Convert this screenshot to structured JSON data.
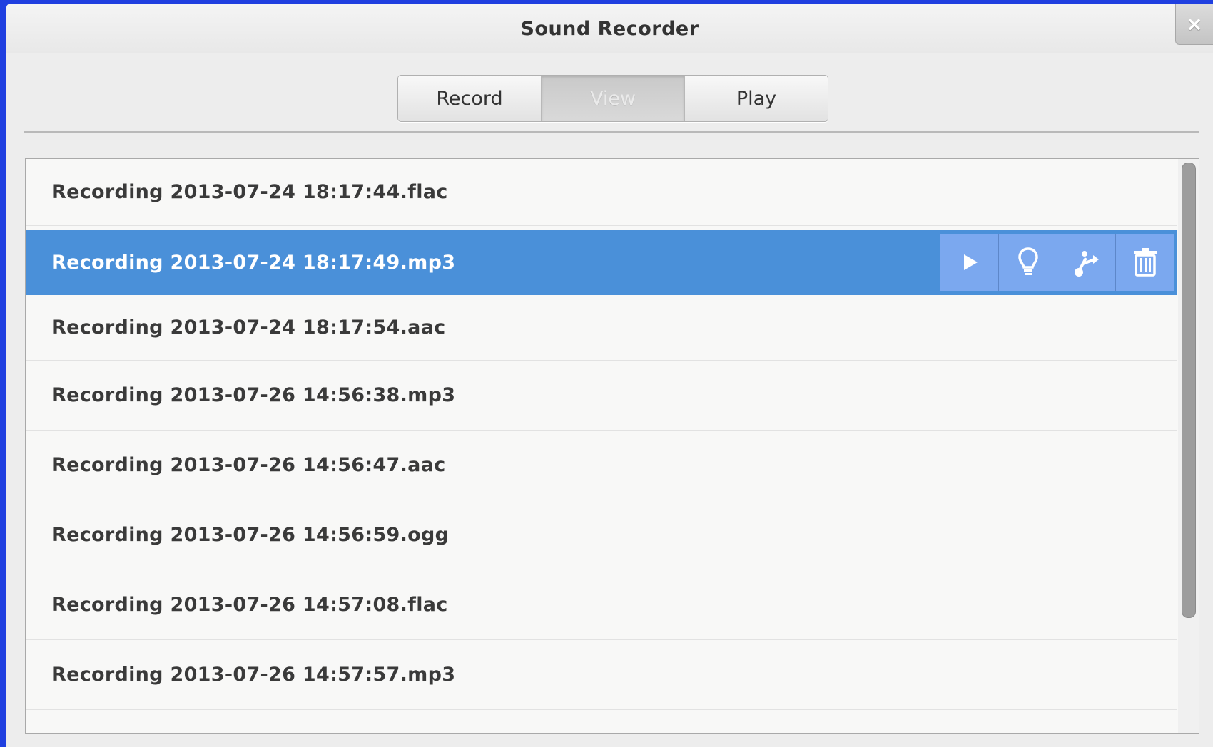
{
  "window": {
    "title": "Sound Recorder",
    "close_label": "×"
  },
  "tabs": [
    {
      "label": "Record",
      "active": false
    },
    {
      "label": "View",
      "active": true
    },
    {
      "label": "Play",
      "active": false
    }
  ],
  "recordings": [
    "Recording 2013-07-24 18:17:44.flac",
    "Recording 2013-07-24 18:17:49.mp3",
    "Recording 2013-07-24 18:17:54.aac",
    "Recording 2013-07-26 14:56:38.mp3",
    "Recording 2013-07-26 14:56:47.aac",
    "Recording 2013-07-26 14:56:59.ogg",
    "Recording 2013-07-26 14:57:08.flac",
    "Recording 2013-07-26 14:57:57.mp3"
  ],
  "selected_index": 1,
  "row_actions": [
    {
      "icon": "play-icon"
    },
    {
      "icon": "info-bulb-icon"
    },
    {
      "icon": "share-icon"
    },
    {
      "icon": "trash-icon"
    }
  ],
  "colors": {
    "selection": "#4a90d9",
    "action_button": "#7ba8ef",
    "desktop": "#1f3fe0"
  }
}
